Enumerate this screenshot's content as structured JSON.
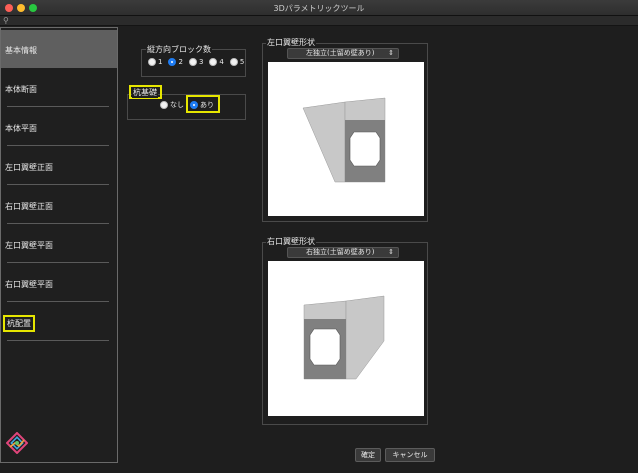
{
  "window": {
    "title": "3Dパラメトリックツール"
  },
  "sidebar": {
    "items": [
      {
        "label": "基本情報"
      },
      {
        "label": "本体断面"
      },
      {
        "label": "本体平面"
      },
      {
        "label": "左口翼壁正面"
      },
      {
        "label": "右口翼壁正面"
      },
      {
        "label": "左口翼壁平面"
      },
      {
        "label": "右口翼壁平面"
      },
      {
        "label": "杭配置"
      }
    ]
  },
  "block_count": {
    "title": "縦方向ブロック数",
    "options": [
      "1",
      "2",
      "3",
      "4",
      "5"
    ],
    "selected": "2"
  },
  "pile_foundation": {
    "title": "杭基礎",
    "options": [
      "なし",
      "あり"
    ],
    "selected": "あり"
  },
  "left_wing": {
    "title": "左口翼壁形状",
    "select_value": "左独立(土留め壁あり)"
  },
  "right_wing": {
    "title": "右口翼壁形状",
    "select_value": "右独立(土留め壁あり)"
  },
  "buttons": {
    "ok": "確定",
    "cancel": "キャンセル"
  },
  "colors": {
    "light_gray": "#c8c8c8",
    "dark_gray": "#808080",
    "highlight": "#e6e600",
    "radio_selected": "#1f7cf2"
  }
}
